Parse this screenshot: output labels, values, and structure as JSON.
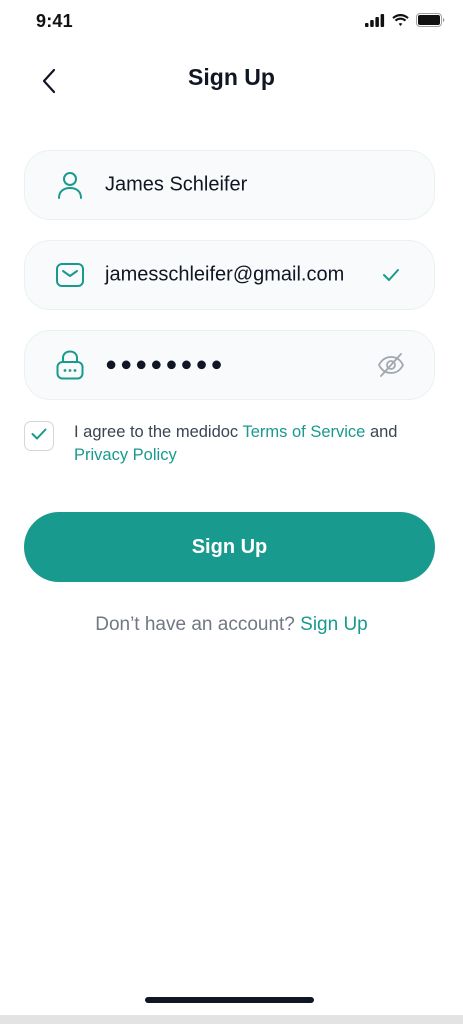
{
  "status_bar": {
    "time": "9:41",
    "icons": [
      "cellular-signal-icon",
      "wifi-icon",
      "battery-icon"
    ]
  },
  "header": {
    "back_icon": "chevron-left-icon",
    "title": "Sign Up"
  },
  "form": {
    "name": {
      "icon": "user-icon",
      "value": "James Schleifer"
    },
    "email": {
      "icon": "mail-icon",
      "value": "jamesschleifer@gmail.com",
      "valid_icon": "checkmark-icon"
    },
    "password": {
      "icon": "lock-icon",
      "masked_value": "●●●●●●●●",
      "toggle_icon": "eye-off-icon"
    }
  },
  "agreement": {
    "checked": true,
    "text_prefix": "I agree to the medidoc ",
    "terms_link": "Terms of Service",
    "text_and": " and",
    "privacy_link": "Privacy Policy"
  },
  "submit": {
    "label": "Sign Up"
  },
  "footer": {
    "prompt": "Don’t have an account? ",
    "link": "Sign Up"
  },
  "colors": {
    "accent": "#199a8e",
    "text": "#101623",
    "muted": "#717784",
    "field_bg": "#f9fafb",
    "field_border": "#e8f3f1"
  }
}
